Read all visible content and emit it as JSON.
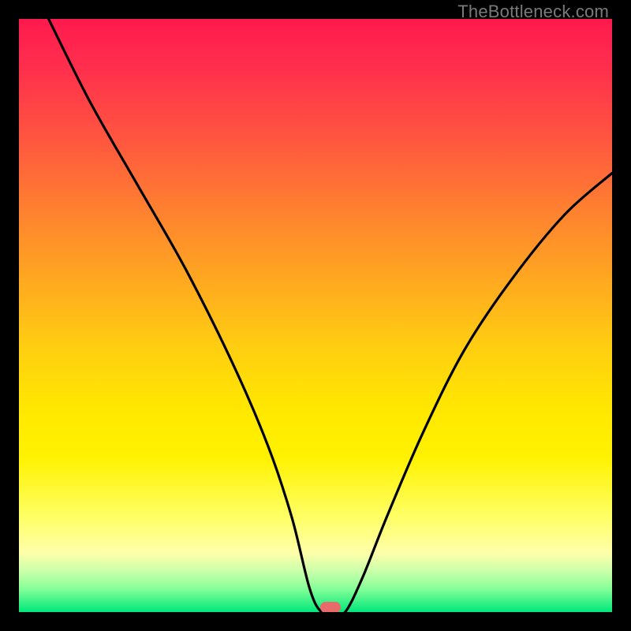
{
  "watermark": "TheBottleneck.com",
  "marker": {
    "x_pct": 52.5,
    "y_pct": 99.2
  },
  "colors": {
    "frame": "#000000",
    "curve": "#000000",
    "marker": "#e86a6a",
    "watermark": "#7a7a7a"
  },
  "chart_data": {
    "type": "line",
    "title": "",
    "xlabel": "",
    "ylabel": "",
    "xlim": [
      0,
      100
    ],
    "ylim": [
      0,
      100
    ],
    "series": [
      {
        "name": "bottleneck-curve",
        "x": [
          5,
          12,
          20,
          28,
          36,
          42,
          46,
          49,
          51,
          53,
          55,
          58,
          62,
          68,
          75,
          83,
          92,
          100
        ],
        "values": [
          100,
          86,
          72,
          58,
          42,
          28,
          16,
          4,
          0,
          0,
          0,
          6,
          16,
          30,
          44,
          56,
          67,
          74
        ]
      }
    ],
    "annotations": [
      {
        "type": "marker",
        "x": 52.5,
        "y": 0.8,
        "shape": "pill",
        "color": "#e86a6a"
      }
    ]
  }
}
